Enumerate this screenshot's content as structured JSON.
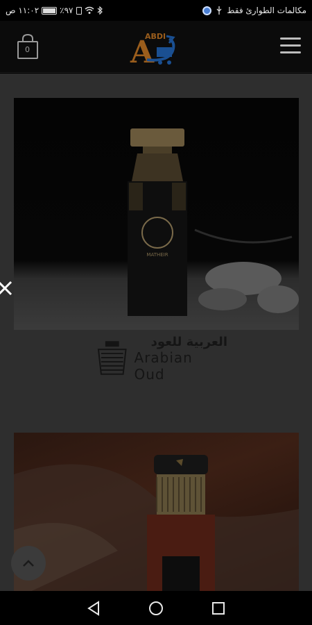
{
  "status_bar": {
    "time": "١١:٠٢ ص",
    "battery": "٪٩٧",
    "carrier_text": "مكالمات الطوارئ فقط",
    "battery_level": 0.97
  },
  "header": {
    "logo_text": "ABDI",
    "logo_letter": "A",
    "cart_count": "0"
  },
  "products": [
    {
      "bottle_label": "MATHEIR",
      "brand_arabic": "العربية للعود",
      "brand_english": "Arabian Oud"
    },
    {
      "bottle_label": ""
    }
  ],
  "colors": {
    "overlay": "#2e2e2e",
    "logo_orange": "#e07a1e",
    "logo_blue": "#1d6fd6"
  }
}
